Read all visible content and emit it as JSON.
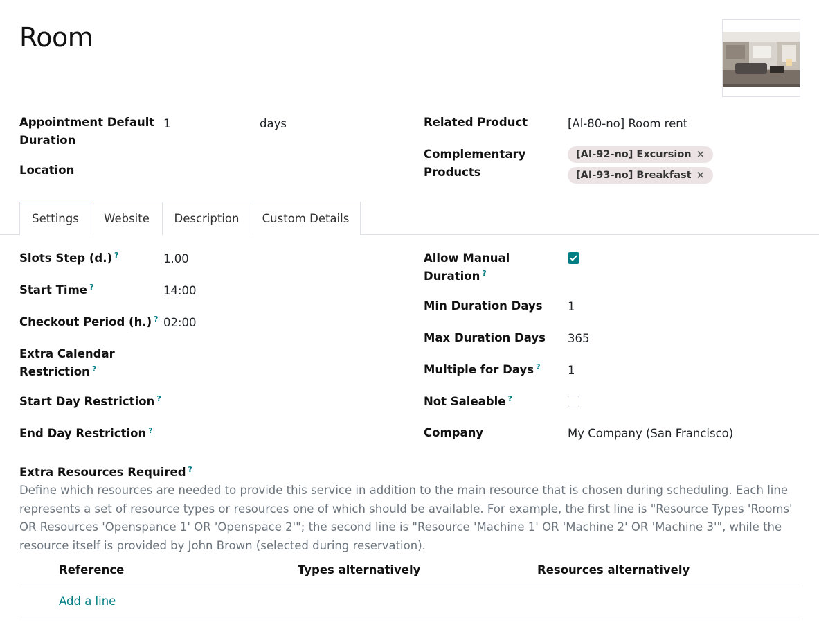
{
  "record": {
    "title": "Room"
  },
  "fields_top_left": {
    "default_duration_label_1": "Appointment Default",
    "default_duration_label_2": "Duration",
    "default_duration_value": "1",
    "default_duration_unit": "days",
    "location_label": "Location"
  },
  "fields_top_right": {
    "related_product_label": "Related Product",
    "related_product_value": "[Al-80-no] Room rent",
    "complementary_label_1": "Complementary",
    "complementary_label_2": "Products",
    "complementary_tags": [
      "[AI-92-no] Excursion",
      "[AI-93-no] Breakfast"
    ],
    "tag_remove_glyph": "✕"
  },
  "tabs": [
    {
      "label": "Settings",
      "active": true
    },
    {
      "label": "Website",
      "active": false
    },
    {
      "label": "Description",
      "active": false
    },
    {
      "label": "Custom Details",
      "active": false
    }
  ],
  "settings_left": {
    "slots_step_label": "Slots Step (d.)",
    "slots_step_value": "1.00",
    "start_time_label": "Start Time",
    "start_time_value": "14:00",
    "checkout_label": "Checkout Period (h.)",
    "checkout_value": "02:00",
    "extra_cal_label_1": "Extra Calendar",
    "extra_cal_label_2": "Restriction",
    "start_day_label": "Start Day Restriction",
    "end_day_label": "End Day Restriction"
  },
  "settings_right": {
    "allow_manual_label_1": "Allow Manual",
    "allow_manual_label_2": "Duration",
    "allow_manual_checked": true,
    "min_days_label": "Min Duration Days",
    "min_days_value": "1",
    "max_days_label": "Max Duration Days",
    "max_days_value": "365",
    "multiple_label": "Multiple for Days",
    "multiple_value": "1",
    "not_saleable_label": "Not Saleable",
    "not_saleable_checked": false,
    "company_label": "Company",
    "company_value": "My Company (San Francisco)"
  },
  "help_glyph": "?",
  "extra_resources": {
    "label": "Extra Resources Required",
    "description": "Define which resources are needed to provide this service in addition to the main resource that is chosen during scheduling. Each line represents a set of resource types or resources one of which should be available. For example, the first line is \"Resource Types 'Rooms' OR Resources 'Openspance 1' OR 'Openspace 2'\"; the second line is \"Resource 'Machine 1' OR 'Machine 2' OR 'Machine 3'\", while the resource itself is provided by John Brown (selected during reservation).",
    "columns": [
      "Reference",
      "Types alternatively",
      "Resources alternatively"
    ],
    "add_line_label": "Add a line"
  },
  "colors": {
    "accent": "#017e84",
    "tag_bg": "#ebe3e4",
    "muted_text": "#6c757d",
    "border": "#dee2e6"
  }
}
